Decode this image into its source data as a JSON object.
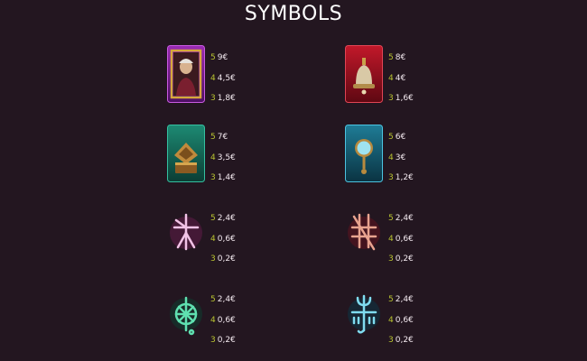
{
  "title": "SYMBOLS",
  "colors": {
    "background": "#231620",
    "count": "#b9c430",
    "value": "#f2e8ee"
  },
  "symbols": [
    {
      "icon": "portrait-card-icon",
      "pays": [
        {
          "count": "5",
          "value": "9€"
        },
        {
          "count": "4",
          "value": "4,5€"
        },
        {
          "count": "3",
          "value": "1,8€"
        }
      ]
    },
    {
      "icon": "bell-card-icon",
      "pays": [
        {
          "count": "5",
          "value": "8€"
        },
        {
          "count": "4",
          "value": "4€"
        },
        {
          "count": "3",
          "value": "1,6€"
        }
      ]
    },
    {
      "icon": "book-card-icon",
      "pays": [
        {
          "count": "5",
          "value": "7€"
        },
        {
          "count": "4",
          "value": "3,5€"
        },
        {
          "count": "3",
          "value": "1,4€"
        }
      ]
    },
    {
      "icon": "mirror-card-icon",
      "pays": [
        {
          "count": "5",
          "value": "6€"
        },
        {
          "count": "4",
          "value": "3€"
        },
        {
          "count": "3",
          "value": "1,2€"
        }
      ]
    },
    {
      "icon": "pink-rune-icon",
      "pays": [
        {
          "count": "5",
          "value": "2,4€"
        },
        {
          "count": "4",
          "value": "0,6€"
        },
        {
          "count": "3",
          "value": "0,2€"
        }
      ]
    },
    {
      "icon": "red-rune-icon",
      "pays": [
        {
          "count": "5",
          "value": "2,4€"
        },
        {
          "count": "4",
          "value": "0,6€"
        },
        {
          "count": "3",
          "value": "0,2€"
        }
      ]
    },
    {
      "icon": "green-wheel-rune-icon",
      "pays": [
        {
          "count": "5",
          "value": "2,4€"
        },
        {
          "count": "4",
          "value": "0,6€"
        },
        {
          "count": "3",
          "value": "0,2€"
        }
      ]
    },
    {
      "icon": "cyan-trident-rune-icon",
      "pays": [
        {
          "count": "5",
          "value": "2,4€"
        },
        {
          "count": "4",
          "value": "0,6€"
        },
        {
          "count": "3",
          "value": "0,2€"
        }
      ]
    }
  ]
}
